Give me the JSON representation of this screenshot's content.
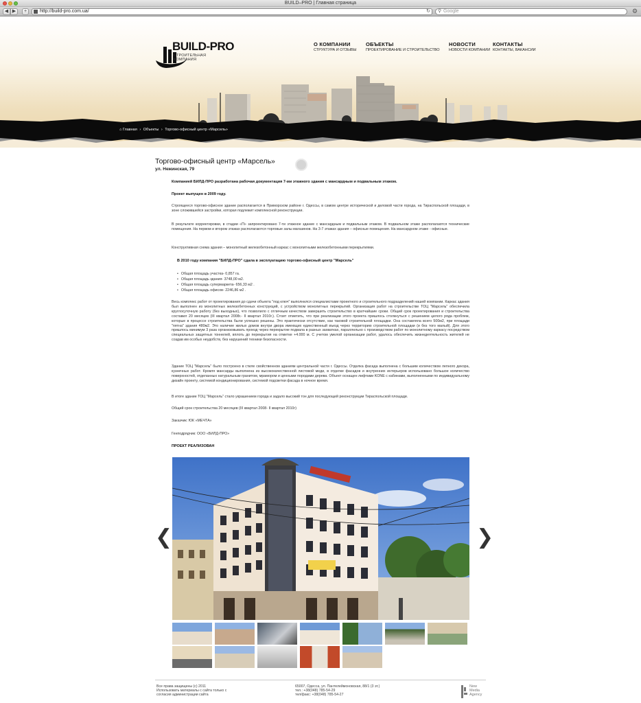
{
  "browser": {
    "window_title": "BUILD–PRO | Главная страница",
    "url": "http://build-pro.com.ua/",
    "search_placeholder": "Google",
    "back": "◀",
    "forward": "▶",
    "add": "+"
  },
  "site": {
    "logo_title": "BUILD-PRO",
    "logo_subtitle": "СТРОИТЕЛЬНАЯ КОМПАНИЯ",
    "menu": [
      {
        "title": "О КОМПАНИИ",
        "sub": "СТРУКТУРА И ОТЗЫВЫ"
      },
      {
        "title": "ОБЪЕКТЫ",
        "sub": "ПРОЕКТИРОВАНИЕ И СТРОИТЕЛЬСТВО"
      },
      {
        "title": "НОВОСТИ",
        "sub": "НОВОСТИ КОМПАНИИ"
      },
      {
        "title": "КОНТАКТЫ",
        "sub": "КОНТАКТЫ, ВАКАНСИИ"
      }
    ],
    "breadcrumb": [
      "Главная",
      "Объекты",
      "Торгово-офисный центр «Марсель»"
    ]
  },
  "content": {
    "title": "Торгово-офисный центр «Марсель»",
    "address": "ул. Нежинская, 79",
    "intro_bold": "Компанией БИЛД-ПРО разработана рабочая документация 7-ми этажного здания с мансардным и подвальным этажом.",
    "released_bold": "Проект выпущен в 2009 году.",
    "p1": "Строящееся торгово-офисное здание располагается в Приморском районе г. Одессы, в самом центре исторической и деловой части города, на Тираспольской площади, в зоне сложившейся застройки, которая подлежит комплексной реконструкции.",
    "p2": "В результате корректировки, в стадии «П» запроектировано 7-ти этажное здание с мансардным и подвальным этажом. В подвальном этаже располагаются технические помещения. На первом  и втором этажах располагаются торговые залы магазинов.  На 3-7 этажах здания – офисные помещения. На мансардном этаже -  офисные.",
    "p3": "Конструктивная схема здания – монолитный железобетонный каркас с монолитными железобетонными перекрытиями.",
    "handover_bold": "В 2010 году компания \"БИЛД-ПРО\" сдала в эксплуатацию торгово-офисный центр \"Марсель\"",
    "bullets": [
      "Общая площадь участка- 0,857 га.",
      "Общая площадь здания- 3748,00 м2.",
      "Общая площадь  супермаркета- 656,33 м2 .",
      "Общая площадь офисов- 2246,86 м2 ."
    ],
    "p4": "Весь комплекс работ от проектирования до сдачи объекта \"под ключ\" выполнился специалистами проектного и строительного подразделений нашей компании. Каркас здания был выполнен из монолитных железобетонных конструкций, с устройством монолитных перекрытий. Организация работ на строительстве ТОЦ \"Марсель\" обеспечила круглосуточную работу (без выходных), что позволило с отличным качеством завершить строительство в кратчайшие сроки. Общий срок проектирования и строительства составил 20 месяцев (III квартал 2008г.- II квартал 2010г.). Стоит отметить, что при реализации этого проекта пришлось столкнуться с решением целого ряда проблем, которые в процессе строительства были успешно решены. Это практически отсутствие, как таковой строительной площадки. Она составляла всего 500м2, при площади \"пятна\" здания 480м2. Это наличие жилых домов внутри двора имеющих единственный въезд через территорию строительной площадки (и без того малый). Для этого пришлось минимум 3 раза организовывать проезд через перекрытие подвала в разных захватках, параллельно с производством работ по монолитному каркасу посредством специальных защитных тоннелей, вплоть до перекрытия на отметке +4.000 м. С учетом умелой организации работ, удалось обеспечить жизнедеятельность жителей не создав им особых неудобств, без нарушений техники безопасности.",
    "p5": "Здание ТОЦ \"Марсель\" было построено в стиле свойственном зданиям центральной части г. Одессы. Отделка фасада выполнена с большим количеством лепного декора, кузнечных работ. Кровля мансарды выполнена из высококачественной листовой меди, в отделке фасадов и внутренних интерьеров использовано большое количество поверхностей, отделанных натуральным гранитом, мрамором и ценными породами дерева. Объект оснащен лифтами KONE с кабинами, выполненными по индивидуальному дизайн проекту, системой кондиционирования, системой подсветки фасада в ночное время.",
    "p6": "В итоге здание ТОЦ \"Марсель\" стало украшением города и задало высокий тон для последующей реконструкции Тираспольской площади.",
    "term": "Общий срок строительства   20 месяцев (III  квартал 2008- II  квартал 2010г)",
    "customer": "Заказчик: ЮК «МЕЧТА»",
    "contractor": "Генподрядчик: ООО «БИЛД-ПРО»",
    "realized_bold": "ПРОЕКТ РЕАЛИЗОВАН",
    "prev_arrow": "❮",
    "next_arrow": "❯"
  },
  "footer": {
    "left_lines": [
      "Все права защищены (c) 2011",
      "Использовать материалы с сайта только с",
      "согласия администрации сайта"
    ],
    "mid_lines": [
      "65007, Одесса, ул. Пантелеймоновская, 88/1 (3 эт.)",
      "тел.:          +38(048) 785-54-29",
      "тел/факс: +38(048) 785-54-27"
    ],
    "agency_lines": [
      "New",
      "Media",
      "Agency"
    ]
  },
  "colors": {
    "accent": "#111111",
    "header_sand": "#e9d4a8",
    "ground": "#0b0b0b"
  }
}
